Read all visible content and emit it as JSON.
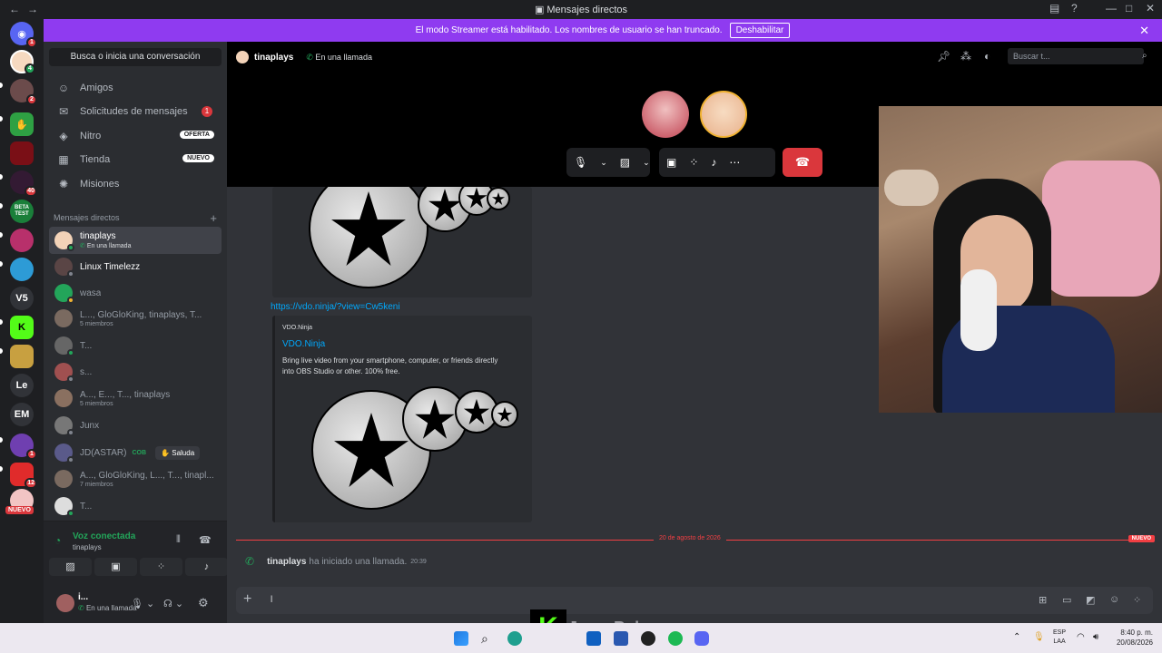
{
  "window": {
    "title": "Mensajes directos"
  },
  "banner": {
    "text": "El modo Streamer está habilitado. Los nombres de usuario se han truncado.",
    "button": "Deshabilitar"
  },
  "rail": {
    "badges": [
      {
        "label": "1"
      },
      {
        "label": "4"
      },
      {
        "label": "2"
      },
      {
        "label": "40"
      },
      {
        "label": "1"
      },
      {
        "label": "12"
      }
    ],
    "text_guilds": [
      {
        "label": "V5"
      },
      {
        "label": "Le"
      },
      {
        "label": "EM"
      }
    ],
    "beta_label": "BETA TEST",
    "nuevo_label": "NUEVO"
  },
  "sidebar": {
    "search_label": "Busca o inicia una conversación",
    "nav": [
      {
        "label": "Amigos"
      },
      {
        "label": "Solicitudes de mensajes",
        "count": "1"
      },
      {
        "label": "Nitro",
        "pill": "OFERTA"
      },
      {
        "label": "Tienda",
        "pill": "NUEVO"
      },
      {
        "label": "Misiones"
      }
    ],
    "dm_header": "Mensajes directos",
    "dms": [
      {
        "name": "tinaplays",
        "sub": "En una llamada"
      },
      {
        "name": "Linux Timelezz",
        "sub": ""
      },
      {
        "name": "wasa",
        "sub": ""
      },
      {
        "name": "L..., GloGloKing, tinaplays, T...",
        "sub": "5 miembros"
      },
      {
        "name": "T...",
        "sub": ""
      },
      {
        "name": "s...",
        "sub": ""
      },
      {
        "name": "A..., E..., T..., tinaplays",
        "sub": "5 miembros"
      },
      {
        "name": "Junx",
        "sub": ""
      },
      {
        "name": "JD(ASTAR)",
        "sub": "",
        "tag": "COB",
        "action": "Saluda"
      },
      {
        "name": "A..., GloGloKing, L..., T..., tinapl...",
        "sub": "7 miembros"
      },
      {
        "name": "T...",
        "sub": ""
      }
    ]
  },
  "voice": {
    "status": "Voz conectada",
    "channel": "tinaplays"
  },
  "user": {
    "name": "i...",
    "status": "En una llamada"
  },
  "header": {
    "name": "tinaplays",
    "status": "En una llamada",
    "search_placeholder": "Buscar t..."
  },
  "messages": {
    "link": "https://vdo.ninja/?view=Cw5keni",
    "embed": {
      "site": "VDO.Ninja",
      "title": "VDO.Ninja",
      "desc": "Bring live video from your smartphone, computer, or friends directly into OBS Studio or other. 100% free."
    },
    "divider_date": "20 de agosto de 2026",
    "new_badge": "NUEVO",
    "system": {
      "user": "tinaplays",
      "text": "ha iniciado una llamada.",
      "time": "20:39"
    },
    "composer_text": "l"
  },
  "overlay": {
    "logo_letter": "K",
    "stream_name": "JessyBaby"
  },
  "taskbar": {
    "lang1": "ESP",
    "lang2": "LAA",
    "time": "8:40 p. m.",
    "date": "20/08/2026"
  },
  "colors": {
    "accent": "#5865f2",
    "banner": "#8f3bf0",
    "danger": "#da373c",
    "online": "#23a55a",
    "link": "#00a8fc"
  }
}
